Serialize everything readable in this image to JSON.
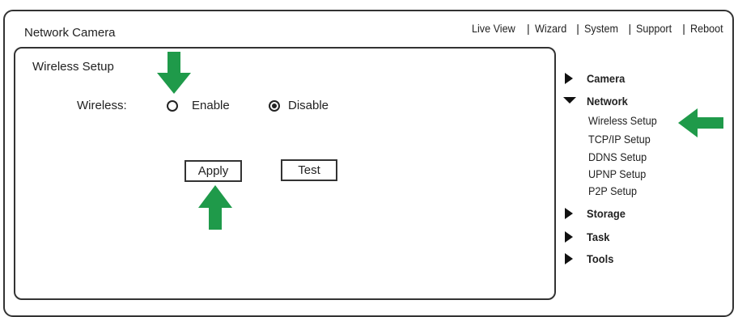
{
  "header": {
    "title": "Network Camera",
    "nav": [
      {
        "label": "Live View"
      },
      {
        "label": "Wizard"
      },
      {
        "label": "System"
      },
      {
        "label": "Support"
      },
      {
        "label": "Reboot"
      }
    ]
  },
  "panel": {
    "title": "Wireless Setup",
    "wireless_label": "Wireless:",
    "options": [
      {
        "label": "Enable",
        "checked": false
      },
      {
        "label": "Disable",
        "checked": true
      }
    ],
    "apply_label": "Apply",
    "test_label": "Test"
  },
  "sidebar": {
    "items": [
      {
        "label": "Camera",
        "expanded": false
      },
      {
        "label": "Network",
        "expanded": true
      },
      {
        "label": "Storage",
        "expanded": false
      },
      {
        "label": "Task",
        "expanded": false
      },
      {
        "label": "Tools",
        "expanded": false
      }
    ],
    "network_sub": [
      {
        "label": "Wireless Setup"
      },
      {
        "label": "TCP/IP Setup"
      },
      {
        "label": "DDNS Setup"
      },
      {
        "label": "UPNP Setup"
      },
      {
        "label": "P2P Setup"
      }
    ]
  },
  "annotations": {
    "arrow_color": "#1f9a4a",
    "arrows": [
      "arrow-down-icon",
      "arrow-up-icon",
      "arrow-left-icon"
    ]
  }
}
